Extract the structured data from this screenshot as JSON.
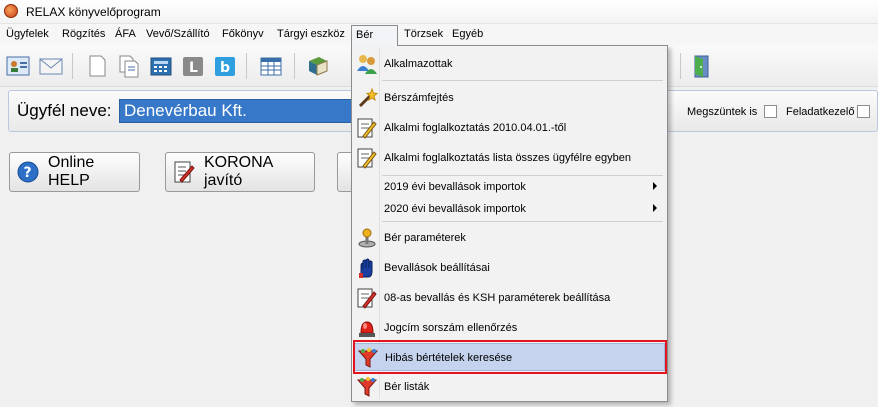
{
  "window": {
    "title": "RELAX könyvelőprogram"
  },
  "menubar": {
    "items": [
      "Ügyfelek",
      "Rögzítés",
      "ÁFA",
      "Vevő/Szállító",
      "Főkönyv",
      "Tárgyi eszköz",
      "Bér",
      "Törzsek",
      "Egyéb"
    ],
    "active": "Bér"
  },
  "client": {
    "label": "Ügyfél neve:",
    "name": "Denevérbau Kft.",
    "checkbox_closed": "Megszüntek is",
    "checkbox_processor": "Feladatkezelő"
  },
  "buttons": {
    "help": "Online HELP",
    "korona": "KORONA javító"
  },
  "dropdown": {
    "items": [
      {
        "label": "Alkalmazottak",
        "icon": "people-icon"
      },
      {
        "label": "Bérszámfejtés",
        "icon": "magic-wand-icon"
      },
      {
        "label": "Alkalmi foglalkoztatás 2010.04.01.-től",
        "icon": "edit-document-icon"
      },
      {
        "label": "Alkalmi foglalkoztatás lista összes ügyfélre egyben",
        "icon": "edit-document-icon"
      },
      {
        "label": "2019 évi bevallások importok",
        "icon": "",
        "submenu": true
      },
      {
        "label": "2020 évi bevallások importok",
        "icon": "",
        "submenu": true
      },
      {
        "label": "Bér paraméterek",
        "icon": "joystick-icon"
      },
      {
        "label": "Bevallások beállításai",
        "icon": "hand-settings-icon"
      },
      {
        "label": "08-as bevallás és KSH paraméterek beállítása",
        "icon": "edit-document-icon"
      },
      {
        "label": "Jogcím sorszám ellenőrzés",
        "icon": "alarm-light-icon"
      },
      {
        "label": "Hibás bértételek keresése",
        "icon": "filter-icon",
        "highlighted": true
      },
      {
        "label": "Bér listák",
        "icon": "filter-icon"
      }
    ]
  },
  "colors": {
    "highlight": "#c5d3ee",
    "client_field": "#3778c8",
    "red_outline": "#e2151f"
  }
}
